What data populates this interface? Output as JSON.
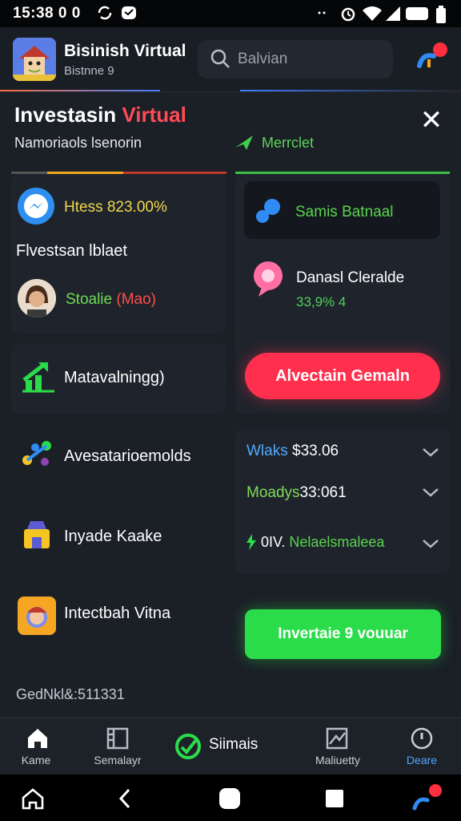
{
  "status_bar": {
    "time": "15:38 0 0"
  },
  "header": {
    "app_title": "Bisinish Virtual",
    "app_subtitle": "Bistnne 9",
    "search_placeholder": "Balvian"
  },
  "hero": {
    "title_part1": "Investasin ",
    "title_part2": "Virtual",
    "subtitle": "Namoriaols lsenorin",
    "market_label": "Merrclet"
  },
  "left_card": {
    "hits_text": "Htess 823.00%",
    "platform_text": "Flvestsan lblaet",
    "status_green": "Stoalie ",
    "status_red": "(Mao)"
  },
  "right_card": {
    "samis_text": "Samis Batnaal",
    "danasi_title": "Danasl Cleralde",
    "danasi_pct": "33,9% 4",
    "red_button": "Alvectain Gemaln"
  },
  "mid_card": {
    "label": "Matavalningg)"
  },
  "rows": {
    "row1_label": "Avesatarioemolds",
    "row2_label": "Inyade Kaake",
    "row3_label": "Intectbah Vitna"
  },
  "prices": {
    "line1_blue": "Wlaks ",
    "line1_white": "$33.06",
    "line2_green": "Moadys",
    "line2_white": "33:061",
    "line3_white": "0IV. ",
    "line3_green": "Nelaelsmaleea"
  },
  "green_button": "Invertaie 9 vouuar",
  "footer_code": "GedNkl&:511331",
  "bottom_nav": {
    "home": "Kame",
    "second": "Semalayr",
    "center": "Siimais",
    "fourth": "Maliuetty",
    "fifth": "Deare"
  },
  "colors": {
    "accent_red": "#ff2f4d",
    "accent_green": "#2bdc4a",
    "background": "#1b1f26"
  }
}
